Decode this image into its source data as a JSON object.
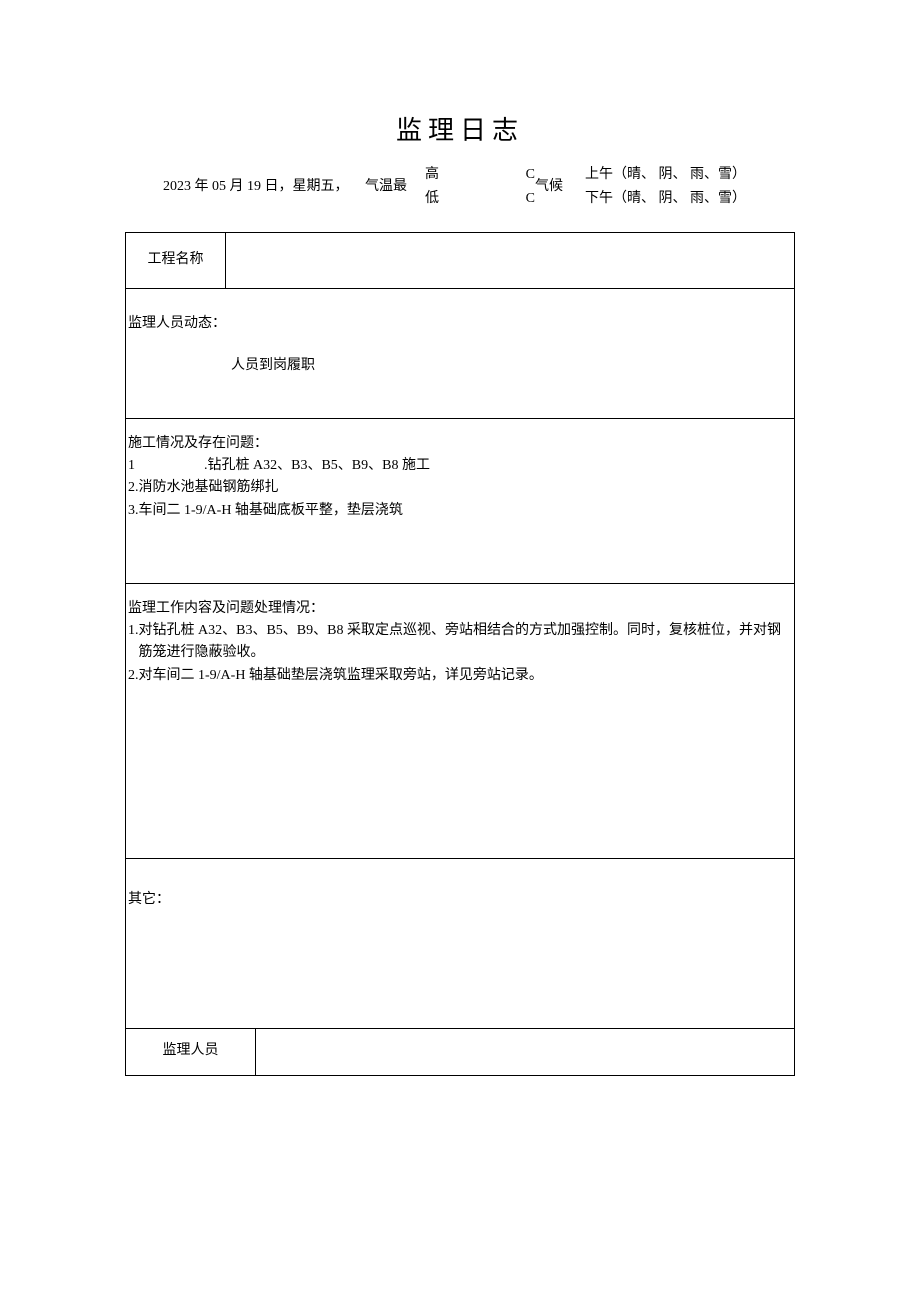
{
  "title": "监理日志",
  "header": {
    "date": "2023 年 05 月 19 日，星期五，",
    "temp_label": "气温最",
    "high_label": "高",
    "low_label": "低",
    "unit": "C",
    "climate_label": "气候",
    "am": "上午（晴、 阴、 雨、雪）",
    "pm": "下午（晴、 阴、 雨、雪）"
  },
  "project": {
    "label": "工程名称",
    "value": ""
  },
  "personnel": {
    "heading": "监理人员动态：",
    "content": "人员到岗履职"
  },
  "construction": {
    "heading": "施工情况及存在问题：",
    "items": [
      {
        "num": "1",
        "text": ".钻孔桩 A32、B3、B5、B9、B8 施工"
      },
      {
        "num": "2.",
        "text": "消防水池基础钢筋绑扎"
      },
      {
        "num": "3.",
        "text": "车间二 1-9/A-H 轴基础底板平整，垫层浇筑"
      }
    ]
  },
  "supervision": {
    "heading": "监理工作内容及问题处理情况：",
    "items": [
      {
        "num": "1.",
        "text": "对钻孔桩 A32、B3、B5、B9、B8 采取定点巡视、旁站相结合的方式加强控制。同时，复核桩位，并对钢筋笼进行隐蔽验收。"
      },
      {
        "num": "2.",
        "text": "对车间二 1-9/A-H 轴基础垫层浇筑监理采取旁站，详见旁站记录。"
      }
    ]
  },
  "other": {
    "heading": "其它："
  },
  "signature": {
    "label": "监理人员",
    "value": ""
  }
}
